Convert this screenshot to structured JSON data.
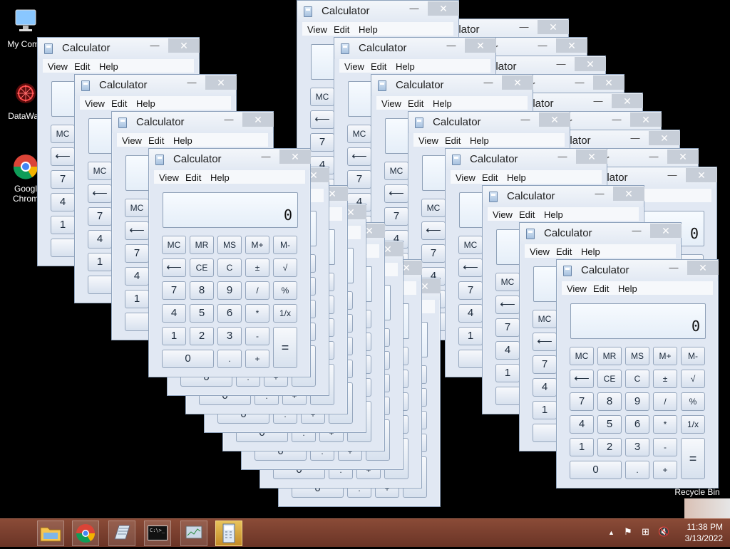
{
  "desktop": {
    "icons": [
      {
        "label": "My Comp",
        "icon": "my-computer-icon"
      },
      {
        "label": "DataWag",
        "icon": "datawag-icon"
      },
      {
        "label": "Googl\nChrom",
        "icon": "chrome-icon"
      },
      {
        "label": "Recycle Bin",
        "icon": "recycle-bin-icon"
      }
    ]
  },
  "calculator": {
    "title": "Calculator",
    "minimize_symbol": "—",
    "close_symbol": "✕",
    "menu": [
      "View",
      "Edit",
      "Help"
    ],
    "display": "0",
    "keys": {
      "mc": "MC",
      "mr": "MR",
      "ms": "MS",
      "mplus": "M+",
      "mminus": "M-",
      "back": "⟵",
      "ce": "CE",
      "c": "C",
      "pm": "±",
      "sqrt": "√",
      "seven": "7",
      "eight": "8",
      "nine": "9",
      "div": "/",
      "pct": "%",
      "four": "4",
      "five": "5",
      "six": "6",
      "mul": "*",
      "recip": "1/x",
      "one": "1",
      "two": "2",
      "three": "3",
      "sub": "-",
      "zero": "0",
      "dot": ".",
      "add": "+",
      "eq": "="
    }
  },
  "taskbar": {
    "buttons": [
      {
        "name": "file-explorer",
        "icon": "folder-icon"
      },
      {
        "name": "chrome",
        "icon": "chrome-icon"
      },
      {
        "name": "app",
        "icon": "notepad-icon"
      },
      {
        "name": "cmd",
        "icon": "cmd-icon",
        "text": "C:\\>_"
      },
      {
        "name": "performance",
        "icon": "monitor-icon"
      },
      {
        "name": "calculator",
        "icon": "calculator-icon",
        "active": true
      }
    ],
    "tray": {
      "show_hidden": "▲",
      "flag": "⚑",
      "network": "⊞",
      "volume": "🔇"
    },
    "clock": {
      "time": "11:38 PM",
      "date": "3/13/2022"
    }
  },
  "colors": {
    "desktop_bg": "#000000",
    "taskbar_bg": "#7b3e2d",
    "window_bg": "#e1e8f3",
    "close_button": "#c7ced8"
  }
}
